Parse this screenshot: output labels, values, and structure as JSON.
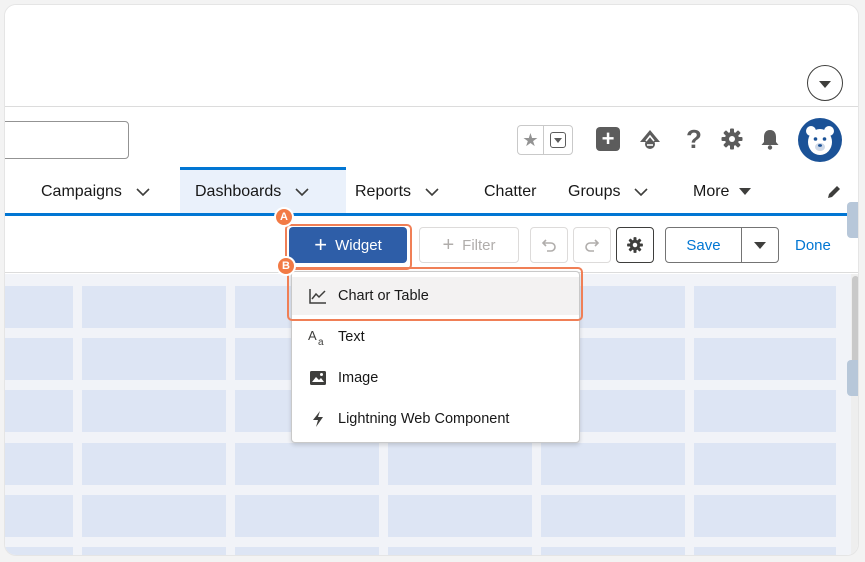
{
  "nav": {
    "items": [
      {
        "label": "Campaigns"
      },
      {
        "label": "Dashboards"
      },
      {
        "label": "Reports"
      },
      {
        "label": "Chatter"
      },
      {
        "label": "Groups"
      },
      {
        "label": "More"
      }
    ]
  },
  "toolbar": {
    "widget_label": "Widget",
    "filter_label": "Filter",
    "save_label": "Save",
    "done_label": "Done"
  },
  "widget_menu": {
    "items": [
      {
        "label": "Chart or Table",
        "icon": "line-chart-icon"
      },
      {
        "label": "Text",
        "icon": "text-aa-icon"
      },
      {
        "label": "Image",
        "icon": "image-icon"
      },
      {
        "label": "Lightning Web Component",
        "icon": "lightning-icon"
      }
    ]
  },
  "annotations": {
    "badge_a": "A",
    "badge_b": "B"
  },
  "colors": {
    "brand_blue": "#0176d3",
    "widget_button": "#2e5ea8",
    "highlight": "#f07f56",
    "grid_cell": "#dde5f4"
  }
}
